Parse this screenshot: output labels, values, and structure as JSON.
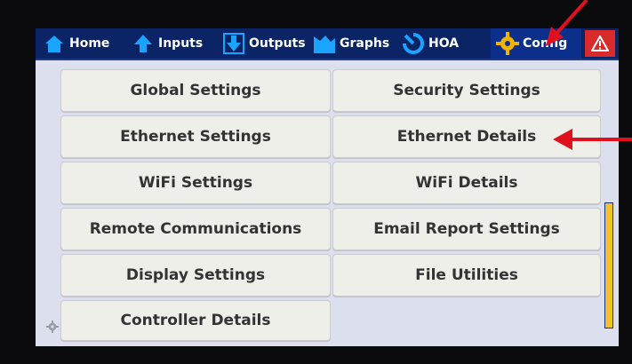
{
  "nav": {
    "tabs": [
      {
        "label": "Home",
        "icon": "home-icon"
      },
      {
        "label": "Inputs",
        "icon": "up-arrow-icon"
      },
      {
        "label": "Outputs",
        "icon": "down-arrow-icon"
      },
      {
        "label": "Graphs",
        "icon": "graph-icon"
      },
      {
        "label": "HOA",
        "icon": "hoa-icon"
      },
      {
        "label": "Config",
        "icon": "gear-icon",
        "active": true
      }
    ],
    "alert_icon": "warning-icon"
  },
  "menu": {
    "left": [
      "Global Settings",
      "Ethernet Settings",
      "WiFi Settings",
      "Remote Communications",
      "Display Settings",
      "Controller Details"
    ],
    "right": [
      "Security Settings",
      "Ethernet Details",
      "WiFi Details",
      "Email Report Settings",
      "File Utilities"
    ]
  },
  "colors": {
    "nav_background": "#0a2466",
    "content_background": "#dcdfed",
    "button_background": "#eeefe9",
    "alert": "#d92b2b",
    "annotation_arrow": "#e0101e",
    "scrollbar": "#f2c12e"
  }
}
